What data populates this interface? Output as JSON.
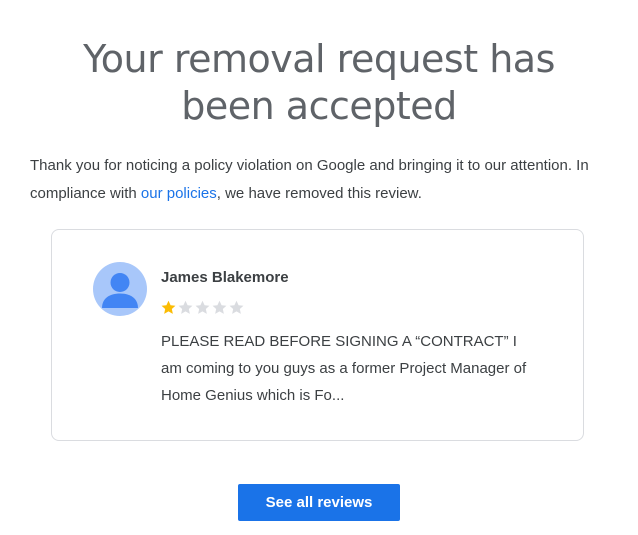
{
  "headline": {
    "line1": "Your removal request has",
    "line2": "been accepted"
  },
  "message": {
    "before_link": "Thank you for noticing a policy violation on Google and bringing it to our attention. In compliance with ",
    "link_text": "our policies",
    "after_link": ", we have removed this review."
  },
  "review": {
    "avatar_icon": "person-avatar-icon",
    "reviewer_name": "James Blakemore",
    "rating": 1,
    "max_rating": 5,
    "text": "PLEASE READ BEFORE SIGNING A “CONTRACT” I am coming to you guys as a former Project Manager of Home Genius which is Fo..."
  },
  "actions": {
    "see_all_label": "See all reviews"
  },
  "colors": {
    "accent": "#1a73e8",
    "star_filled": "#fbbc04",
    "star_empty": "#dadce0",
    "avatar_bg": "#a8c7fa",
    "avatar_fg": "#4285f4"
  }
}
